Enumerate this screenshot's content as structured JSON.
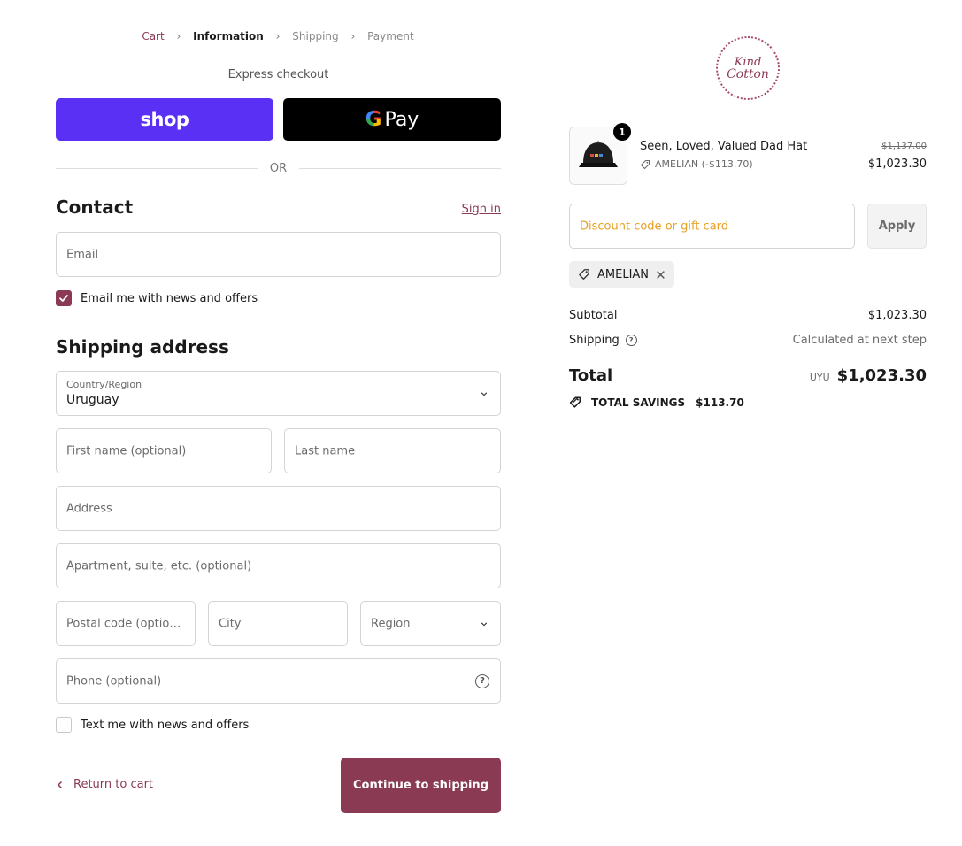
{
  "breadcrumb": {
    "cart": "Cart",
    "information": "Information",
    "shipping": "Shipping",
    "payment": "Payment"
  },
  "express": {
    "title": "Express checkout",
    "shop_label": "shop",
    "gpay_label": "Pay",
    "or_label": "OR"
  },
  "contact": {
    "heading": "Contact",
    "sign_in": "Sign in",
    "email_placeholder": "Email",
    "news_label": "Email me with news and offers",
    "news_checked": true
  },
  "shipping_address": {
    "heading": "Shipping address",
    "country_label": "Country/Region",
    "country_value": "Uruguay",
    "first_name_placeholder": "First name (optional)",
    "last_name_placeholder": "Last name",
    "address_placeholder": "Address",
    "apartment_placeholder": "Apartment, suite, etc. (optional)",
    "postal_placeholder": "Postal code (optional)",
    "city_placeholder": "City",
    "region_placeholder": "Region",
    "phone_placeholder": "Phone (optional)",
    "text_news_label": "Text me with news and offers",
    "text_news_checked": false
  },
  "footer": {
    "return_label": "Return to cart",
    "continue_label": "Continue to shipping"
  },
  "summary": {
    "logo_line1": "Kind",
    "logo_line2": "Cotton",
    "item": {
      "quantity": "1",
      "name": "Seen, Loved, Valued Dad Hat",
      "discount": "AMELIAN (-$113.70)",
      "original_price": "$1,137.00",
      "price": "$1,023.30"
    },
    "discount_placeholder": "Discount code or gift card",
    "apply_label": "Apply",
    "applied_code": "AMELIAN",
    "subtotal_label": "Subtotal",
    "subtotal_value": "$1,023.30",
    "shipping_label": "Shipping",
    "shipping_value": "Calculated at next step",
    "total_label": "Total",
    "currency": "UYU",
    "total_value": "$1,023.30",
    "savings_label": "TOTAL SAVINGS",
    "savings_value": "$113.70"
  },
  "colors": {
    "accent": "#8a3a52",
    "shop_pay": "#5a31f4",
    "placeholder_orange": "#e8a022"
  }
}
